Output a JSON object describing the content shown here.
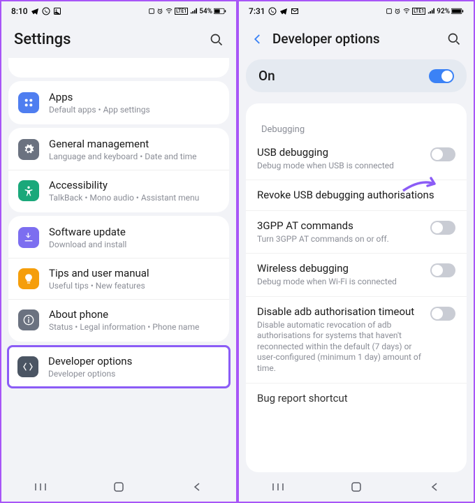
{
  "left": {
    "status": {
      "time": "8:10",
      "battery": "54%",
      "net": "LTE1"
    },
    "title": "Settings",
    "card_stub_item_visibility": "partial",
    "groups": [
      {
        "items": [
          {
            "title": "Apps",
            "sub": "Default apps  •  App settings",
            "icon": "apps-icon",
            "color": "#4f7ef0"
          }
        ]
      },
      {
        "items": [
          {
            "title": "General management",
            "sub": "Language and keyboard  •  Date and time",
            "icon": "gear-icon",
            "color": "#6b7280"
          },
          {
            "title": "Accessibility",
            "sub": "TalkBack  •  Mono audio  •  Assistant menu",
            "icon": "accessibility-icon",
            "color": "#1aa87a"
          }
        ]
      },
      {
        "items": [
          {
            "title": "Software update",
            "sub": "Download and install",
            "icon": "update-icon",
            "color": "#7c6ef0"
          },
          {
            "title": "Tips and user manual",
            "sub": "Useful tips  •  New features",
            "icon": "tips-icon",
            "color": "#f59e0b"
          },
          {
            "title": "About phone",
            "sub": "Status  •  Legal information  •  Phone name",
            "icon": "info-icon",
            "color": "#6b7280"
          }
        ]
      }
    ],
    "highlight": {
      "title": "Developer options",
      "sub": "Developer options",
      "icon": "developer-icon",
      "color": "#4b5563"
    },
    "nav": [
      "recent",
      "home",
      "back"
    ]
  },
  "right": {
    "status": {
      "time": "7:31",
      "battery": "92%",
      "net": "LTE1"
    },
    "title": "Developer options",
    "on_label": "On",
    "on_state": true,
    "section_label": "Debugging",
    "items": [
      {
        "title": "USB debugging",
        "sub": "Debug mode when USB is connected",
        "toggle": "off",
        "annotated": true
      },
      {
        "title": "Revoke USB debugging authorisations",
        "sub": "",
        "toggle": null
      },
      {
        "title": "3GPP AT commands",
        "sub": "Turn 3GPP AT commands on or off.",
        "toggle": "off"
      },
      {
        "title": "Wireless debugging",
        "sub": "Debug mode when Wi-Fi is connected",
        "toggle": "off"
      },
      {
        "title": "Disable adb authorisation timeout",
        "sub": "Disable automatic revocation of adb authorisations for systems that haven't reconnected within the default (7 days) or user-configured (minimum 1 day) amount of time.",
        "toggle": "off"
      },
      {
        "title": "Bug report shortcut",
        "sub": "",
        "toggle": null,
        "partial": true
      }
    ],
    "nav": [
      "recent",
      "home",
      "back"
    ]
  }
}
